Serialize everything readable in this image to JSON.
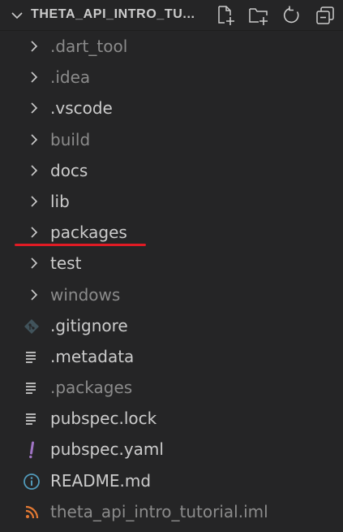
{
  "header": {
    "title": "THETA_API_INTRO_TU...",
    "actions": [
      {
        "icon": "new-file-icon"
      },
      {
        "icon": "new-folder-icon"
      },
      {
        "icon": "refresh-icon"
      },
      {
        "icon": "collapse-all-icon"
      }
    ]
  },
  "tree": {
    "folders": [
      {
        "label": ".dart_tool",
        "dim": true
      },
      {
        "label": ".idea",
        "dim": true
      },
      {
        "label": ".vscode",
        "dim": false
      },
      {
        "label": "build",
        "dim": true
      },
      {
        "label": "docs",
        "dim": false
      },
      {
        "label": "lib",
        "dim": false
      },
      {
        "label": "packages",
        "dim": false
      },
      {
        "label": "test",
        "dim": false
      },
      {
        "label": "windows",
        "dim": true
      }
    ],
    "files": [
      {
        "label": ".gitignore",
        "icon": "git-icon",
        "dim": false
      },
      {
        "label": ".metadata",
        "icon": "lines-icon",
        "dim": false
      },
      {
        "label": ".packages",
        "icon": "lines-icon",
        "dim": true
      },
      {
        "label": "pubspec.lock",
        "icon": "lines-icon",
        "dim": false
      },
      {
        "label": "pubspec.yaml",
        "icon": "exclamation-icon",
        "dim": false
      },
      {
        "label": "README.md",
        "icon": "info-icon",
        "dim": false
      },
      {
        "label": "theta_api_intro_tutorial.iml",
        "icon": "rss-icon",
        "dim": true
      }
    ]
  },
  "colors": {
    "background": "#252526",
    "text": "#cccccc",
    "dim_text": "#8b8b8b",
    "underline": "#e01b24",
    "yaml_icon": "#a074c4",
    "info_icon": "#519aba",
    "rss_icon": "#e37933"
  }
}
